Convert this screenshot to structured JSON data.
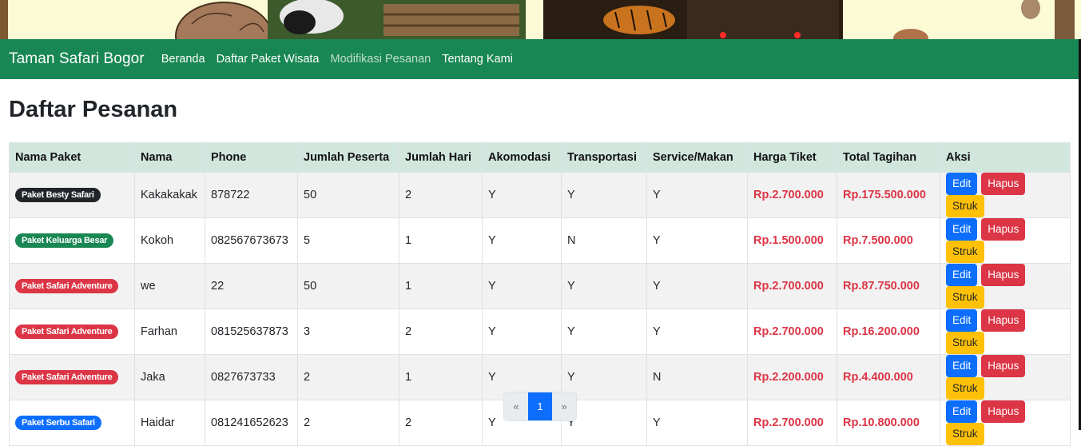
{
  "navbar": {
    "brand": "Taman Safari Bogor",
    "links": [
      {
        "label": "Beranda",
        "active": false
      },
      {
        "label": "Daftar Paket Wisata",
        "active": false
      },
      {
        "label": "Modifikasi Pesanan",
        "active": true
      },
      {
        "label": "Tentang Kami",
        "active": false
      }
    ]
  },
  "page_title": "Daftar Pesanan",
  "table": {
    "headers": [
      "Nama Paket",
      "Nama",
      "Phone",
      "Jumlah Peserta",
      "Jumlah Hari",
      "Akomodasi",
      "Transportasi",
      "Service/Makan",
      "Harga Tiket",
      "Total Tagihan",
      "Aksi"
    ],
    "rows": [
      {
        "paket": "Paket Besty Safari",
        "badge_color": "#212529",
        "nama": "Kakakakak",
        "phone": "878722",
        "peserta": "50",
        "hari": "2",
        "akomodasi": "Y",
        "transportasi": "Y",
        "service": "Y",
        "harga": "Rp.2.700.000",
        "total": "Rp.175.500.000"
      },
      {
        "paket": "Paket Keluarga Besar",
        "badge_color": "#198754",
        "nama": "Kokoh",
        "phone": "082567673673",
        "peserta": "5",
        "hari": "1",
        "akomodasi": "Y",
        "transportasi": "N",
        "service": "Y",
        "harga": "Rp.1.500.000",
        "total": "Rp.7.500.000"
      },
      {
        "paket": "Paket Safari Adventure",
        "badge_color": "#dc3545",
        "nama": "we",
        "phone": "22",
        "peserta": "50",
        "hari": "1",
        "akomodasi": "Y",
        "transportasi": "Y",
        "service": "Y",
        "harga": "Rp.2.700.000",
        "total": "Rp.87.750.000"
      },
      {
        "paket": "Paket Safari Adventure",
        "badge_color": "#dc3545",
        "nama": "Farhan",
        "phone": "081525637873",
        "peserta": "3",
        "hari": "2",
        "akomodasi": "Y",
        "transportasi": "Y",
        "service": "Y",
        "harga": "Rp.2.700.000",
        "total": "Rp.16.200.000"
      },
      {
        "paket": "Paket Safari Adventure",
        "badge_color": "#dc3545",
        "nama": "Jaka",
        "phone": "0827673733",
        "peserta": "2",
        "hari": "1",
        "akomodasi": "Y",
        "transportasi": "Y",
        "service": "N",
        "harga": "Rp.2.200.000",
        "total": "Rp.4.400.000"
      },
      {
        "paket": "Paket Serbu Safari",
        "badge_color": "#0d6efd",
        "nama": "Haidar",
        "phone": "081241652623",
        "peserta": "2",
        "hari": "2",
        "akomodasi": "Y",
        "transportasi": "Y",
        "service": "Y",
        "harga": "Rp.2.700.000",
        "total": "Rp.10.800.000"
      }
    ],
    "actions": {
      "edit": "Edit",
      "hapus": "Hapus",
      "struk": "Struk"
    }
  },
  "pagination": {
    "prev": "«",
    "current": "1",
    "next": "»"
  },
  "colors": {
    "navbar": "#198754",
    "header_bg": "#d1e7dd",
    "price": "#dc3545",
    "edit": "#0d6efd",
    "hapus": "#dc3545",
    "struk": "#ffc107"
  }
}
